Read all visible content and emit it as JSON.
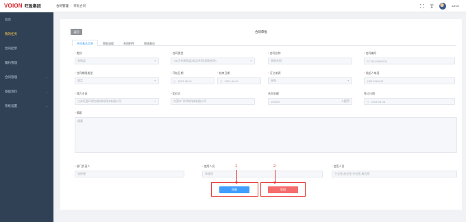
{
  "header": {
    "logo_en": "VOION",
    "logo_cn": "旺盈集团",
    "breadcrumb": [
      "合同管理",
      "审批合同"
    ],
    "breadcrumb_sep": "/",
    "username": "admin"
  },
  "sidebar": {
    "items": [
      {
        "label": "首页",
        "active": false,
        "has_children": false
      },
      {
        "label": "我的任务",
        "active": true,
        "has_children": false
      },
      {
        "label": "合同起草",
        "active": false,
        "has_children": false
      },
      {
        "label": "履约管理",
        "active": false,
        "has_children": false
      },
      {
        "label": "合同管理",
        "active": false,
        "has_children": true
      },
      {
        "label": "基础资料",
        "active": false,
        "has_children": true
      },
      {
        "label": "系统设置",
        "active": false,
        "has_children": true
      }
    ]
  },
  "page": {
    "back_label": "返回",
    "title": "合同审批",
    "tabs": [
      "合同基本信息",
      "审批流程",
      "合同附件",
      "审核意见"
    ],
    "active_tab": 0
  },
  "form": {
    "row1": [
      {
        "label": "类别",
        "required": true,
        "value": "采购类",
        "kind": "select"
      },
      {
        "label": "合同类型",
        "required": true,
        "value": "<50万的采购类/商品合同(采购合同)",
        "kind": "select"
      },
      {
        "label": "合同名称",
        "required": true,
        "value": "采购合同",
        "kind": "text"
      },
      {
        "label": "合同编号",
        "required": true,
        "value": "FC78125890003",
        "kind": "text"
      }
    ],
    "row2": [
      {
        "label": "合同期限类型",
        "required": true,
        "value": "固定",
        "kind": "select"
      },
      {
        "label": "开始日期",
        "required": true,
        "value": "2023-06-01",
        "kind": "date"
      },
      {
        "label": "结束日期",
        "required": false,
        "value": "2024-06-01",
        "kind": "date"
      },
      {
        "label": "订立来源",
        "required": true,
        "value": "采购",
        "kind": "select"
      },
      {
        "label": "发起人电话",
        "required": true,
        "value": "13812345442",
        "kind": "text"
      }
    ],
    "row3": [
      {
        "label": "我方主体",
        "required": true,
        "value": "江苏旺盈环保包装材料科技有限公司",
        "kind": "select"
      },
      {
        "label": "相对方",
        "required": true,
        "value": "东莞市飞印特机械有限公司",
        "kind": "text"
      },
      {
        "label": "合同金额",
        "required": false,
        "value": "100000",
        "suffix": "人民币",
        "kind": "text"
      },
      {
        "label": "签订日期",
        "required": false,
        "value": "2023-06-06",
        "kind": "date"
      }
    ],
    "summary": {
      "label": "摘要",
      "required": true,
      "placeholder": "摘要"
    },
    "row4": [
      {
        "label": "部门负责人",
        "required": true,
        "value": "张经理"
      },
      {
        "label": "使用人员",
        "required": true,
        "value": "李使用"
      },
      {
        "label": "会签人员",
        "required": true,
        "value": "王会签,赵会签,孙会签,周会签"
      }
    ]
  },
  "actions": {
    "approve_label": "同意",
    "reject_label": "驳回",
    "marker1": "1",
    "marker2": "2"
  },
  "colors": {
    "sidebar_bg": "#304156",
    "active_menu": "#ffd04b",
    "primary": "#409eff",
    "danger": "#f56c6c",
    "annotation": "#e53935"
  }
}
